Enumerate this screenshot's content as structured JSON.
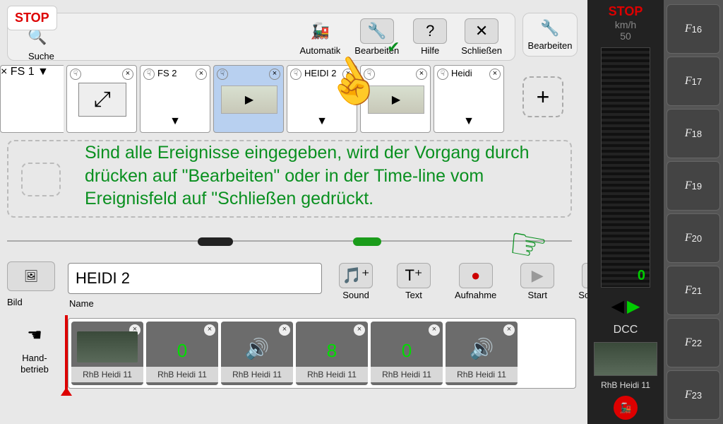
{
  "stop": "STOP",
  "toolbar": {
    "suche": "Suche",
    "automatik": "Automatik",
    "bearbeiten": "Bearbeiten",
    "hilfe": "Hilfe",
    "schliessen": "Schließen"
  },
  "side_edit": "Bearbeiten",
  "cards": {
    "fs1": "FS 1",
    "fs2": "FS 2",
    "heidi2": "HEIDI 2",
    "heidi": "Heidi"
  },
  "instruction": "Sind alle Ereignisse eingegeben, wird der Vorgang durch drücken auf \"Bearbeiten\" oder in der Time-line vom Ereignisfeld auf \"Schließen gedrückt.",
  "bottom": {
    "bild": "Bild",
    "name_label": "Name",
    "name_value": "HEIDI 2",
    "sound": "Sound",
    "text": "Text",
    "aufnahme": "Aufnahme",
    "start": "Start",
    "schliessen": "Schließen",
    "handbetrieb": "Hand-\nbetrieb"
  },
  "timeline": {
    "items": [
      {
        "label": "RhB Heidi 11",
        "kind": "loco"
      },
      {
        "label": "RhB Heidi 11",
        "val": "0"
      },
      {
        "label": "RhB Heidi 11",
        "kind": "sound_on"
      },
      {
        "label": "RhB Heidi 11",
        "val": "8"
      },
      {
        "label": "RhB Heidi 11",
        "val": "0"
      },
      {
        "label": "RhB Heidi 11",
        "kind": "sound"
      }
    ]
  },
  "speed": {
    "stop": "STOP",
    "unit": "km/h",
    "val": "50",
    "zero": "0",
    "dcc": "DCC",
    "name": "RhB Heidi 11"
  },
  "fn": [
    "16",
    "17",
    "18",
    "19",
    "20",
    "21",
    "22",
    "23"
  ]
}
